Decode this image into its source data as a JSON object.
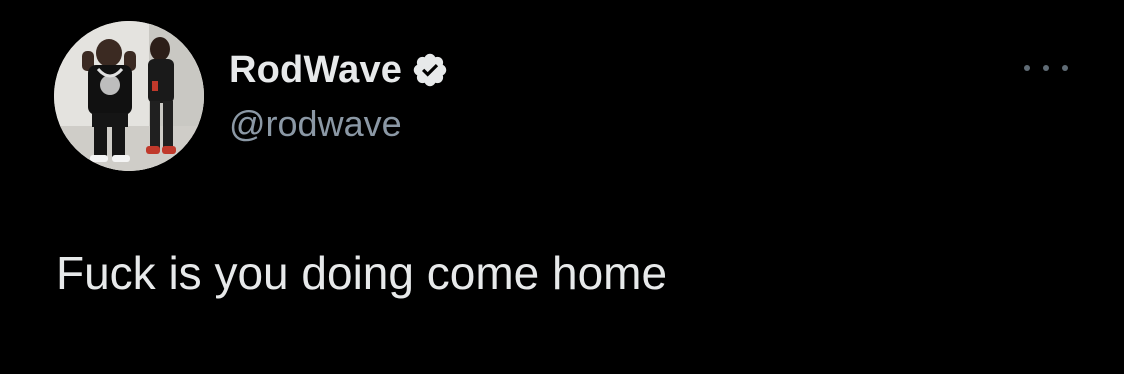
{
  "tweet": {
    "display_name": "RodWave",
    "handle": "@rodwave",
    "verified": true,
    "text": "Fuck is you doing come home"
  },
  "icons": {
    "verified": "verified-badge-icon",
    "more": "more-options-icon"
  },
  "colors": {
    "background": "#000000",
    "primary_text": "#e7e9ea",
    "secondary_text": "#8b98a5",
    "verified_badge": "#e7e9ea"
  }
}
